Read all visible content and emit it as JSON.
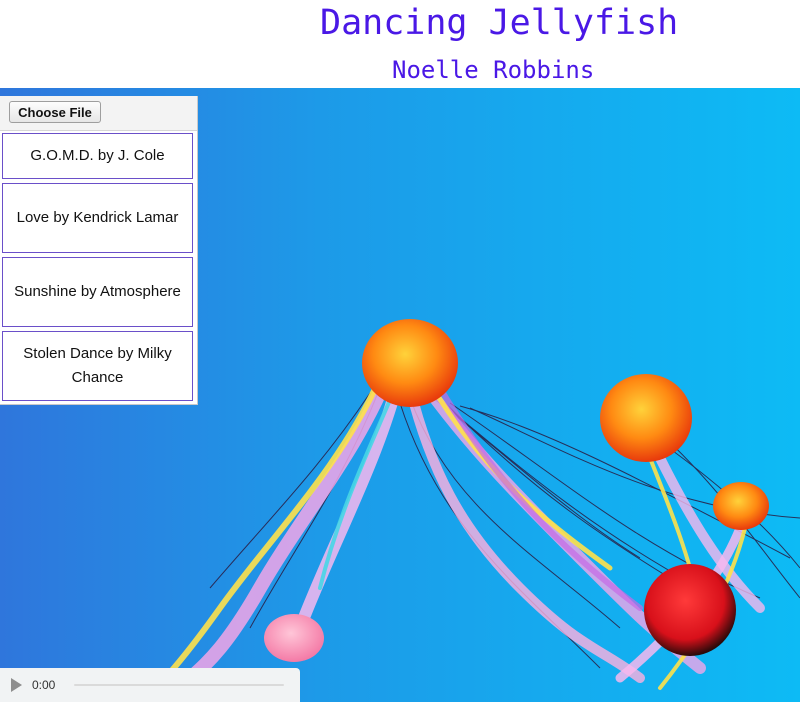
{
  "header": {
    "title": "Dancing Jellyfish",
    "subtitle": "Noelle Robbins"
  },
  "controls": {
    "choose_file_label": "Choose File",
    "songs": [
      {
        "label": "G.O.M.D. by J. Cole"
      },
      {
        "label": "Love by Kendrick Lamar"
      },
      {
        "label": "Sunshine by Atmosphere"
      },
      {
        "label": "Stolen Dance by Milky Chance"
      }
    ]
  },
  "audio_player": {
    "current_time": "0:00",
    "icon": "play-icon"
  },
  "colors": {
    "title": "#4a18e6",
    "background_left": "#2f76dc",
    "background_right": "#0dbbf5",
    "song_border": "#6a4fc9"
  }
}
